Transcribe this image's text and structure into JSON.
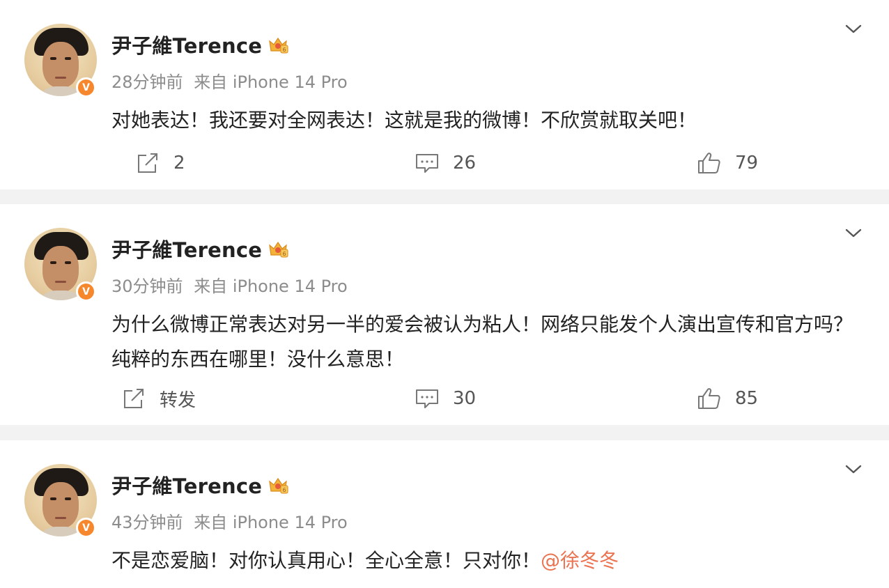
{
  "posts": [
    {
      "username": "尹子維Terence",
      "time": "28分钟前",
      "source": "来自 iPhone 14 Pro",
      "text": "对她表达！我还要对全网表达！这就是我的微博！不欣赏就取关吧！",
      "mention": "",
      "share": "2",
      "comments": "26",
      "likes": "79"
    },
    {
      "username": "尹子維Terence",
      "time": "30分钟前",
      "source": "来自 iPhone 14 Pro",
      "text": "为什么微博正常表达对另一半的爱会被认为粘人！网络只能发个人演出宣传和官方吗？纯粹的东西在哪里！没什么意思！",
      "mention": "",
      "share": "转发",
      "comments": "30",
      "likes": "85"
    },
    {
      "username": "尹子維Terence",
      "time": "43分钟前",
      "source": "来自 iPhone 14 Pro",
      "text": "不是恋爱脑！对你认真用心！全心全意！只对你！",
      "mention": "@徐冬冬"
    }
  ],
  "verified_badge": "V",
  "accent_color": "#eb7350",
  "verified_color": "#f7872c",
  "icons": [
    "avatar",
    "verified-badge",
    "crown-badge-icon",
    "chevron-down-icon",
    "share-icon",
    "comment-icon",
    "like-icon"
  ]
}
